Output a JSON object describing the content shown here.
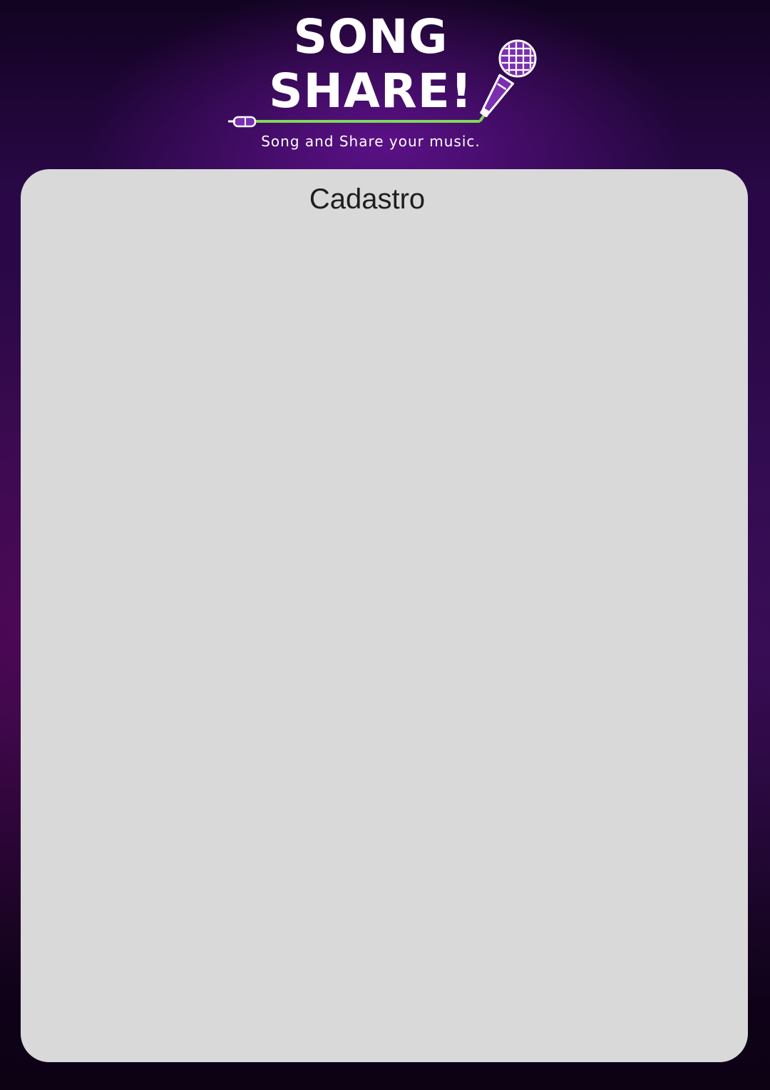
{
  "app": {
    "logo": {
      "line1": "SONG",
      "line2": "SHARE!",
      "icon": "microphone-icon"
    },
    "tagline": "Song and Share your music."
  },
  "card": {
    "title": "Cadastro"
  },
  "colors": {
    "background_dark": "#12031c",
    "background_purple": "#2a0848",
    "card_background": "#d9d9d9",
    "cable_green": "#7ed957",
    "mic_purple": "#7b2fb0",
    "text_white": "#ffffff",
    "text_dark": "#1e1e1e"
  }
}
